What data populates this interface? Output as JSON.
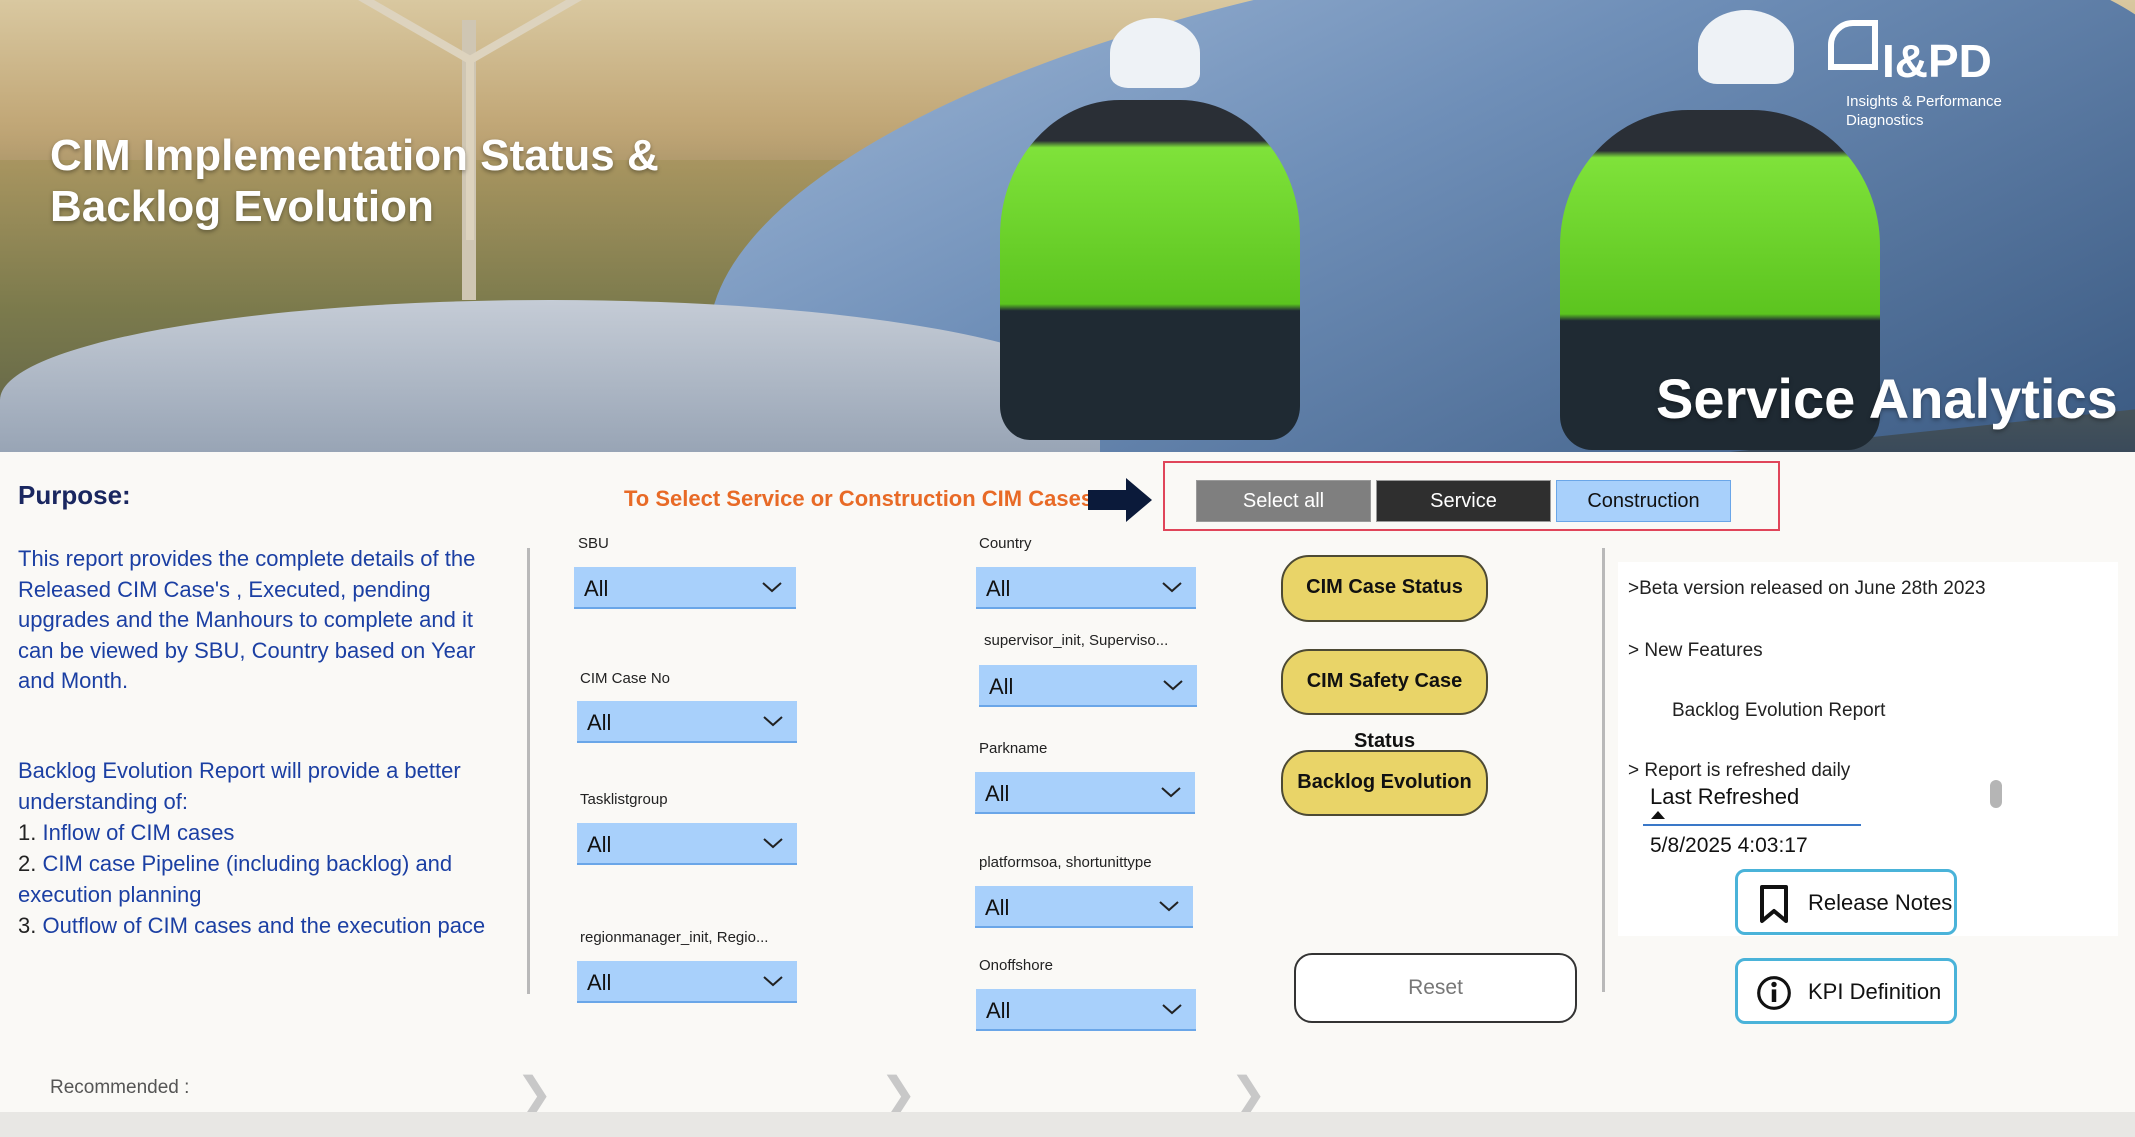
{
  "hero": {
    "title_line1": "CIM Implementation Status &",
    "title_line2": "Backlog Evolution",
    "brand_name": "I&PD",
    "brand_sub_line1": "Insights & Performance",
    "brand_sub_line2": "Diagnostics",
    "service_analytics": "Service Analytics"
  },
  "purpose": {
    "title": "Purpose:",
    "text": "This report  provides the complete details of the  Released CIM Case's , Executed, pending upgrades and the Manhours to complete and it can be viewed by SBU, Country based on Year and Month.",
    "backlog_intro": "Backlog Evolution Report will provide a better understanding of:",
    "items": [
      {
        "num": "1.",
        "text": "Inflow of CIM cases"
      },
      {
        "num": "2.",
        "text": "CIM case Pipeline (including backlog) and execution planning"
      },
      {
        "num": "3.",
        "text": "Outflow of CIM cases and the execution pace"
      }
    ]
  },
  "case_selector": {
    "hint": "To Select Service or Construction CIM Cases",
    "options": [
      "Select all",
      "Service",
      "Construction"
    ],
    "selected": "Construction"
  },
  "slicers_left": [
    {
      "label": "SBU",
      "value": "All"
    },
    {
      "label": "CIM Case No",
      "value": "All"
    },
    {
      "label": "Tasklistgroup",
      "value": "All"
    },
    {
      "label": "regionmanager_init, Regio...",
      "value": "All"
    }
  ],
  "slicers_right": [
    {
      "label": "Country",
      "value": "All"
    },
    {
      "label": "supervisor_init, Superviso...",
      "value": "All"
    },
    {
      "label": "Parkname",
      "value": "All"
    },
    {
      "label": "platformsoa, shortunittype",
      "value": "All"
    },
    {
      "label": "Onoffshore",
      "value": "All"
    }
  ],
  "nav_buttons": {
    "cim_case_status": "CIM Case Status",
    "cim_safety_case_status": "CIM Safety Case Status",
    "backlog_evolution": "Backlog Evolution",
    "reset": "Reset"
  },
  "notes": {
    "beta": ">Beta version released on June 28th 2023",
    "new_features": "> New Features",
    "feature_item": "Backlog Evolution Report",
    "refreshed": "> Report is refreshed daily",
    "last_refreshed_label": "Last Refreshed",
    "last_refreshed_value": "5/8/2025 4:03:17"
  },
  "info_buttons": {
    "release_notes": "Release Notes",
    "kpi_definition": "KPI Definition"
  },
  "footer": {
    "recommended": "Recommended :"
  },
  "colors": {
    "slicer_bg": "#a8d0fb",
    "nav_button_bg": "#e9d468",
    "hint_color": "#e86a26",
    "purpose_text": "#1b3fa3",
    "construction_bg": "#a8d0fb",
    "service_bg": "#2f2f2f",
    "select_all_bg": "#7f7f7f"
  }
}
